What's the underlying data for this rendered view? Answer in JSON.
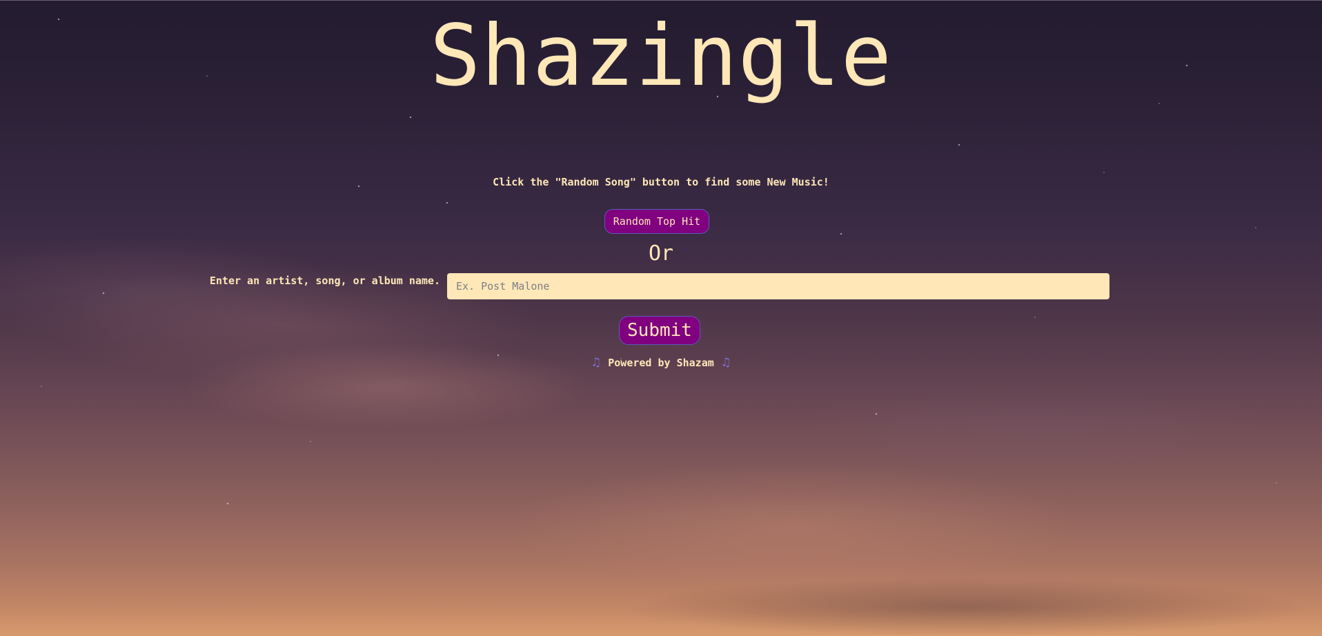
{
  "app": {
    "title": "Shazingle"
  },
  "main": {
    "instructions": "Click the \"Random Song\" button to find some New Music!",
    "random_button_label": "Random Top Hit",
    "or_text": "Or",
    "search": {
      "label": "Enter an artist, song, or album name.",
      "placeholder": "Ex. Post Malone",
      "value": ""
    },
    "submit_label": "Submit"
  },
  "footer": {
    "powered_by": "Powered by Shazam",
    "icon_left": "music-notes-icon",
    "icon_right": "music-notes-icon"
  },
  "colors": {
    "text_accent": "#ffe7b8",
    "button_bg": "#800080",
    "button_border": "#5a5ab8"
  }
}
